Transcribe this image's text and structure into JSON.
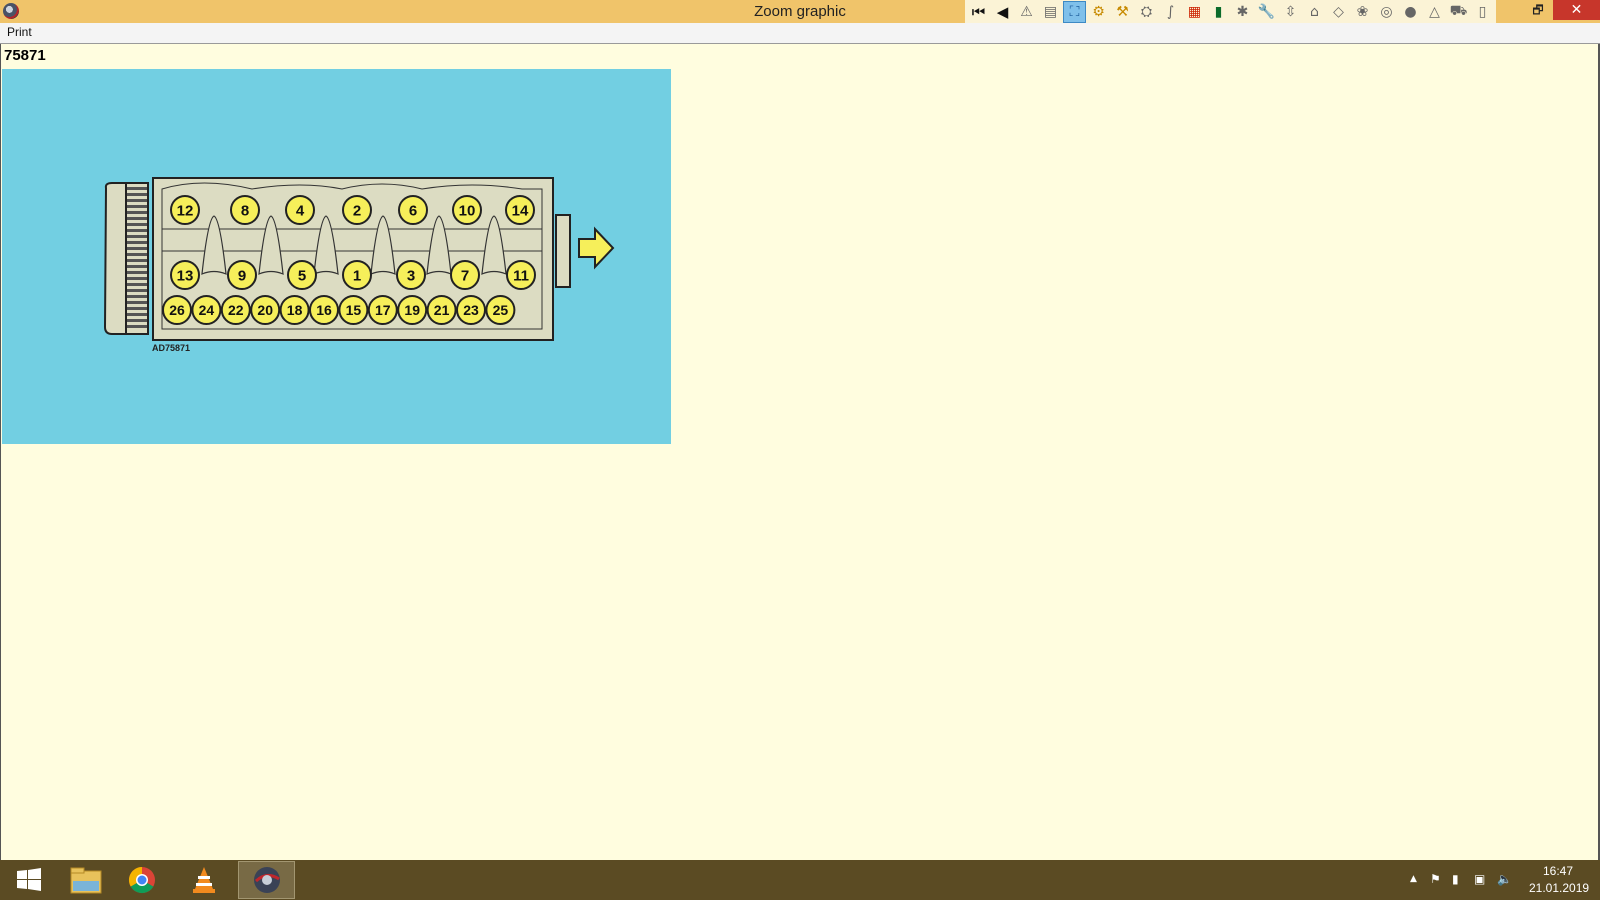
{
  "window": {
    "title": "Zoom graphic",
    "restore_symbol": "🗗",
    "close_symbol": "✕"
  },
  "toolbar": {
    "buttons": [
      {
        "icon": "first-page-icon",
        "glyph": "⏮"
      },
      {
        "icon": "previous-page-icon",
        "glyph": "◀"
      },
      {
        "icon": "warning-icon",
        "glyph": "⚠"
      },
      {
        "icon": "document-icon",
        "glyph": "▤"
      },
      {
        "icon": "zoom-graphic-icon",
        "glyph": "⛶"
      },
      {
        "icon": "settings-icon",
        "glyph": "⚙"
      },
      {
        "icon": "tools-icon",
        "glyph": "⚒"
      },
      {
        "icon": "gear-wheel-icon",
        "glyph": "⛭"
      },
      {
        "icon": "hose-icon",
        "glyph": "∫"
      },
      {
        "icon": "chart-icon",
        "glyph": "▦"
      },
      {
        "icon": "battery-icon",
        "glyph": "▮"
      },
      {
        "icon": "engine-icon",
        "glyph": "✱"
      },
      {
        "icon": "wrench-icon",
        "glyph": "🔧"
      },
      {
        "icon": "jack-icon",
        "glyph": "⇳"
      },
      {
        "icon": "seat-icon",
        "glyph": "⌂"
      },
      {
        "icon": "body-icon",
        "glyph": "◇"
      },
      {
        "icon": "fan-icon",
        "glyph": "❀"
      },
      {
        "icon": "brake-icon",
        "glyph": "◎"
      },
      {
        "icon": "wheel-icon",
        "glyph": "●"
      },
      {
        "icon": "triangle-icon",
        "glyph": "△"
      },
      {
        "icon": "car-icon",
        "glyph": "⛟"
      },
      {
        "icon": "book-icon",
        "glyph": "▯"
      }
    ]
  },
  "menu": {
    "print_label": "Print"
  },
  "graphic": {
    "id_label": "75871",
    "caption": "AD75871",
    "row_top": [
      "12",
      "8",
      "4",
      "2",
      "6",
      "10",
      "14"
    ],
    "row_middle": [
      "13",
      "9",
      "5",
      "1",
      "3",
      "7",
      "11"
    ],
    "row_bottom": [
      "26",
      "24",
      "22",
      "20",
      "18",
      "16",
      "15",
      "17",
      "19",
      "21",
      "23",
      "25"
    ],
    "colors": {
      "panel": "#72cfe2",
      "head": "#dcdcc2",
      "badge": "#f6ef5a",
      "arrow": "#f6ef5a"
    }
  },
  "taskbar": {
    "items": [
      {
        "icon": "windows-start-icon",
        "active": false
      },
      {
        "icon": "file-explorer-icon",
        "active": false
      },
      {
        "icon": "chrome-icon",
        "active": false
      },
      {
        "icon": "vlc-icon",
        "active": false
      },
      {
        "icon": "repair-app-icon",
        "active": true
      }
    ],
    "clock_time": "16:47",
    "clock_date": "21.01.2019"
  }
}
